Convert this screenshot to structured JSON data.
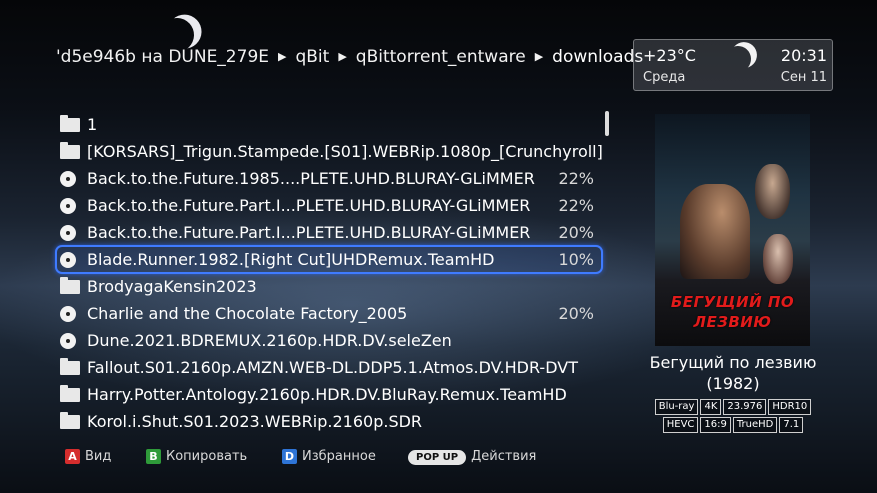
{
  "breadcrumb": {
    "items": [
      "'d5e946b на DUNE_279E",
      "qBit",
      "qBittorrent_entware",
      "downloads"
    ]
  },
  "weather": {
    "temperature": "+23°C",
    "day": "Среда",
    "time": "20:31",
    "date": "Сен 11",
    "icon": "moon-icon"
  },
  "files": [
    {
      "type": "folder",
      "name": "1",
      "percent": ""
    },
    {
      "type": "folder",
      "name": "[KORSARS]_Trigun.Stampede.[S01].WEBRip.1080p_[Crunchyroll]",
      "percent": ""
    },
    {
      "type": "disc",
      "name": "Back.to.the.Future.1985....PLETE.UHD.BLURAY-GLiMMER",
      "percent": "22%"
    },
    {
      "type": "disc",
      "name": "Back.to.the.Future.Part.I...PLETE.UHD.BLURAY-GLiMMER",
      "percent": "22%"
    },
    {
      "type": "disc",
      "name": "Back.to.the.Future.Part.I...PLETE.UHD.BLURAY-GLiMMER",
      "percent": "20%"
    },
    {
      "type": "disc",
      "name": "Blade.Runner.1982.[Right Cut]UHDRemux.TeamHD",
      "percent": "10%",
      "selected": true
    },
    {
      "type": "folder",
      "name": "BrodyagaKensin2023",
      "percent": ""
    },
    {
      "type": "disc",
      "name": "Charlie and the Chocolate Factory_2005",
      "percent": "20%"
    },
    {
      "type": "disc",
      "name": "Dune.2021.BDREMUX.2160p.HDR.DV.seleZen",
      "percent": ""
    },
    {
      "type": "folder",
      "name": "Fallout.S01.2160p.AMZN.WEB-DL.DDP5.1.Atmos.DV.HDR-DVT",
      "percent": ""
    },
    {
      "type": "folder",
      "name": "Harry.Potter.Antology.2160p.HDR.DV.BluRay.Remux.TeamHD",
      "percent": ""
    },
    {
      "type": "folder",
      "name": "Korol.i.Shut.S01.2023.WEBRip.2160p.SDR",
      "percent": ""
    }
  ],
  "movie": {
    "poster_title": "БЕГУЩИЙ ПО ЛЕЗВИЮ",
    "title": "Бегущий по лезвию",
    "year": "(1982)",
    "badges_row1": [
      "Blu-ray",
      "4K",
      "23.976",
      "HDR10"
    ],
    "badges_row2": [
      "HEVC",
      "16:9",
      "TrueHD",
      "7.1"
    ]
  },
  "footer": {
    "a_key": "A",
    "a_label": "Вид",
    "b_key": "B",
    "b_label": "Копировать",
    "d_key": "D",
    "d_label": "Избранное",
    "popup_key": "POP UP",
    "popup_label": "Действия"
  },
  "colors": {
    "selection": "#3f7bff",
    "key_a": "#d52d2d",
    "key_b": "#2f9b3a",
    "key_d": "#2e74d6"
  }
}
